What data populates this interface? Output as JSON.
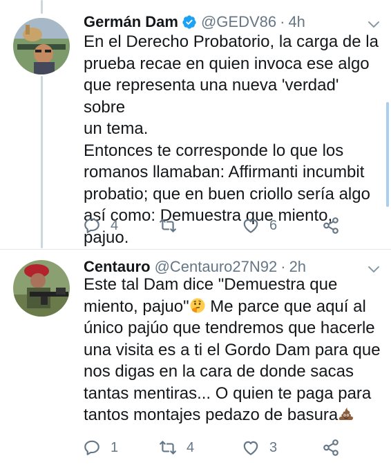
{
  "tweets": [
    {
      "name": "Germán Dam",
      "verified": true,
      "handle": "@GEDV86",
      "separator": "·",
      "time": "4h",
      "text": "En el Derecho Probatorio, la carga de la\nprueba recae en quien invoca ese algo\nque representa una nueva 'verdad' sobre\nun tema.\nEntonces te corresponde lo que los\nromanos llamaban: Affirmanti incumbit\nprobatio; que en buen criollo sería algo\nasí como: Demuestra que miento, pajuo.",
      "replies": "4",
      "retweets": "",
      "likes": "6"
    },
    {
      "name": "Centauro",
      "verified": false,
      "handle": "@Centauro27N92",
      "separator": "·",
      "time": "2h",
      "text_before_emoji1": "Este tal Dam dice \"Demuestra que\nmiento, pajuo\"",
      "emoji1": "thinking-face-emoji",
      "text_after_emoji1": " Me parce que aquí al\núnico pajúo que tendremos que hacerle\nuna visita es a ti el Gordo Dam para que\nnos digas en la cara de donde sacas\ntantas mentiras... O quien te paga para\ntantos montajes pedazo de basura",
      "emoji2": "pile-of-poo-emoji",
      "replies": "1",
      "retweets": "4",
      "likes": "3"
    }
  ],
  "icons": {
    "reply": "reply-icon",
    "retweet": "retweet-icon",
    "like": "heart-icon",
    "share": "share-icon",
    "more": "chevron-down-icon",
    "verified": "verified-badge-icon"
  },
  "colors": {
    "text": "#14171a",
    "secondary": "#657786",
    "verified": "#1da1f2",
    "thread_line": "#ccd6dd"
  }
}
